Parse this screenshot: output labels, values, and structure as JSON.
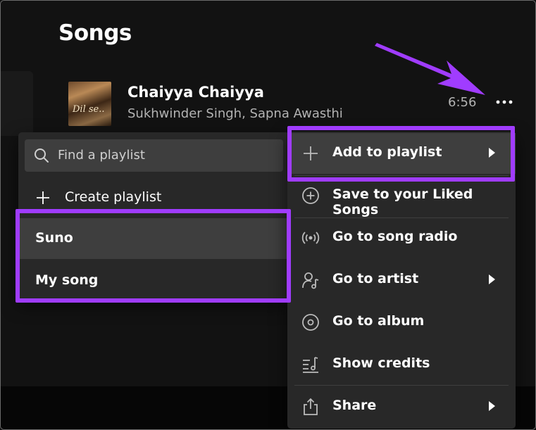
{
  "header": {
    "title": "Songs"
  },
  "song": {
    "title": "Chaiyya Chaiyya",
    "artist": "Sukhwinder Singh, Sapna Awasthi",
    "duration": "6:56",
    "cover_text": "Dil se..",
    "more_label": "···"
  },
  "playlist_menu": {
    "search_placeholder": "Find a playlist",
    "create_label": "Create playlist",
    "playlists": [
      "Suno",
      "My song"
    ]
  },
  "context_menu": {
    "items": [
      {
        "label": "Add to playlist",
        "icon": "plus-icon",
        "submenu": true
      },
      {
        "label": "Save to your Liked Songs",
        "icon": "add-circle-icon",
        "submenu": false
      },
      {
        "label": "Go to song radio",
        "icon": "radio-icon",
        "submenu": false
      },
      {
        "label": "Go to artist",
        "icon": "artist-icon",
        "submenu": true
      },
      {
        "label": "Go to album",
        "icon": "album-icon",
        "submenu": false
      },
      {
        "label": "Show credits",
        "icon": "credits-icon",
        "submenu": false
      },
      {
        "label": "Share",
        "icon": "share-icon",
        "submenu": true
      }
    ]
  },
  "colors": {
    "background": "#121212",
    "menu": "#282828",
    "menu_hover": "#3e3e3e",
    "highlight": "#a03cff",
    "secondary_text": "#b3b3b3"
  }
}
